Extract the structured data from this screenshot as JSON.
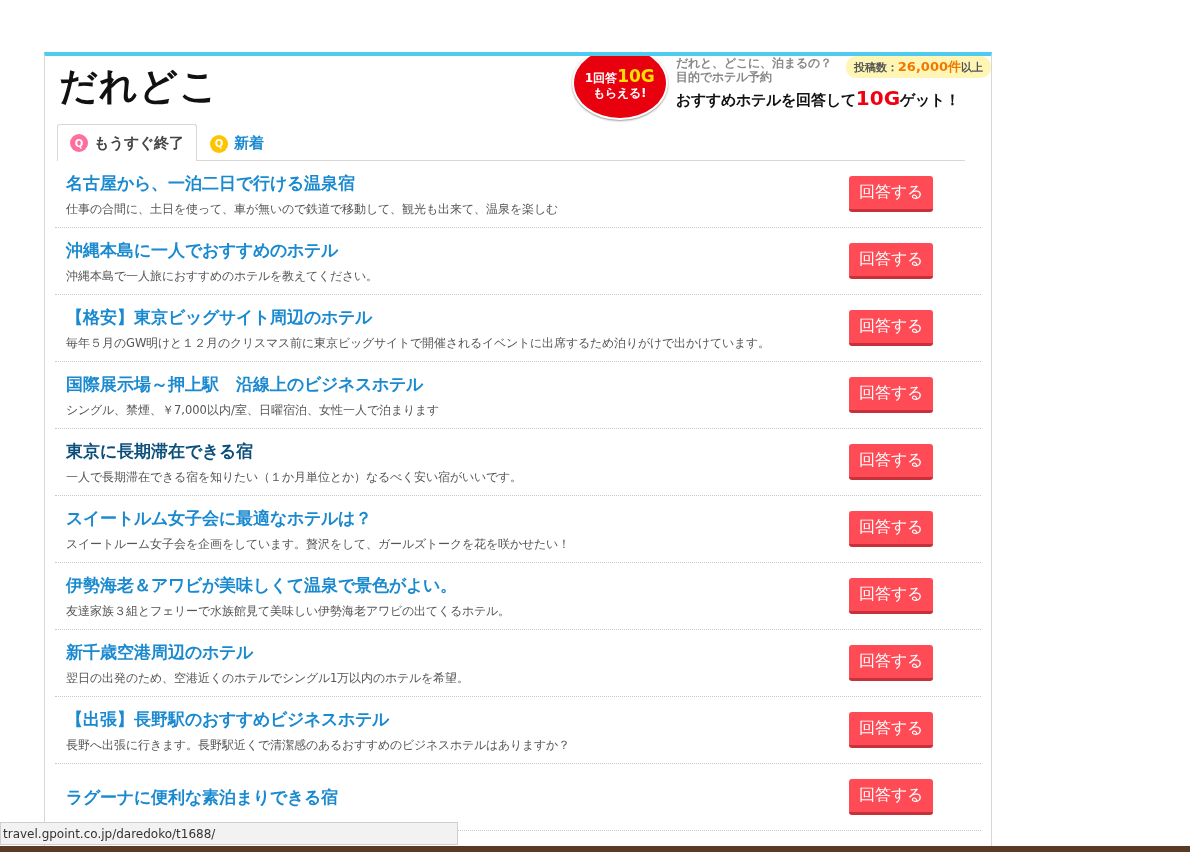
{
  "logo": "だれどこ",
  "promo": {
    "badge": "1回答**10G**",
    "badge_sub": "もらえる!",
    "tagline": [
      "だれと、どこに、泊まるの？",
      "目的でホテル予約"
    ],
    "count": "投稿数：**26,000件**以上",
    "headline": "おすすめホテルを回答して**10G**ゲット！"
  },
  "tabs": [
    {
      "icon": "Q",
      "label": "もうすぐ終了",
      "selected": true,
      "color": "#ff6f9c"
    },
    {
      "icon": "Q",
      "label": "新着",
      "selected": false,
      "color": "#ffc400"
    }
  ],
  "questions": [
    {
      "title": "名古屋から、一泊二日で行ける温泉宿",
      "description": "仕事の合間に、土日を使って、車が無いので鉄道で移動して、観光も出来て、温泉を楽しむ",
      "button": "回答する",
      "hovered": false
    },
    {
      "title": "沖縄本島に一人でおすすめのホテル",
      "description": "沖縄本島で一人旅におすすめのホテルを教えてください。",
      "button": "回答する",
      "hovered": false
    },
    {
      "title": "【格安】東京ビッグサイト周辺のホテル",
      "description": "毎年５月のGW明けと１２月のクリスマス前に東京ビッグサイトで開催されるイベントに出席するため泊りがけで出かけています。",
      "button": "回答する",
      "hovered": false
    },
    {
      "title": "国際展示場～押上駅　沿線上のビジネスホテル",
      "description": "シングル、禁煙、￥7,000以内/室、日曜宿泊、女性一人で泊まります",
      "button": "回答する",
      "hovered": false
    },
    {
      "title": "東京に長期滞在できる宿",
      "description": "一人で長期滞在できる宿を知りたい（１か月単位とか）なるべく安い宿がいいです。",
      "button": "回答する",
      "hovered": true
    },
    {
      "title": "スイートルム女子会に最適なホテルは？",
      "description": "スイートルーム女子会を企画をしています。贅沢をして、ガールズトークを花を咲かせたい！",
      "button": "回答する",
      "hovered": false
    },
    {
      "title": "伊勢海老＆アワビが美味しくて温泉で景色がよい。",
      "description": "友達家族３組とフェリーで水族館見て美味しい伊勢海老アワビの出てくるホテル。",
      "button": "回答する",
      "hovered": false
    },
    {
      "title": "新千歳空港周辺のホテル",
      "description": "翌日の出発のため、空港近くのホテルでシングル1万以内のホテルを希望。",
      "button": "回答する",
      "hovered": false
    },
    {
      "title": "【出張】長野駅のおすすめビジネスホテル",
      "description": "長野へ出張に行きます。長野駅近くで清潔感のあるおすすめのビジネスホテルはありますか？",
      "button": "回答する",
      "hovered": false
    },
    {
      "title": "ラグーナに便利な素泊まりできる宿",
      "button": "回答する",
      "hovered": false
    }
  ],
  "status_bar": "travel.gpoint.co.jp/daredoko/t1688/"
}
